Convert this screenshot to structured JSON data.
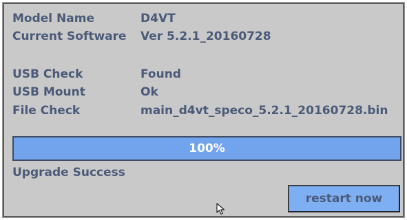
{
  "info": {
    "model_label": "Model Name",
    "model_value": "D4VT",
    "software_label": "Current Software",
    "software_value": "Ver 5.2.1_20160728",
    "usb_check_label": "USB Check",
    "usb_check_value": "Found",
    "usb_mount_label": "USB Mount",
    "usb_mount_value": "Ok",
    "file_check_label": "File Check",
    "file_check_value": "main_d4vt_speco_5.2.1_20160728.bin"
  },
  "progress": {
    "percent": 100,
    "label": "100%"
  },
  "status": "Upgrade Success",
  "restart_button": "restart now",
  "colors": {
    "panel": "#c9c9c9",
    "text": "#4a5a78",
    "progress": "#7da9e8",
    "button": "#7eaff3"
  },
  "icons": {
    "cursor": "mouse-pointer-icon"
  }
}
